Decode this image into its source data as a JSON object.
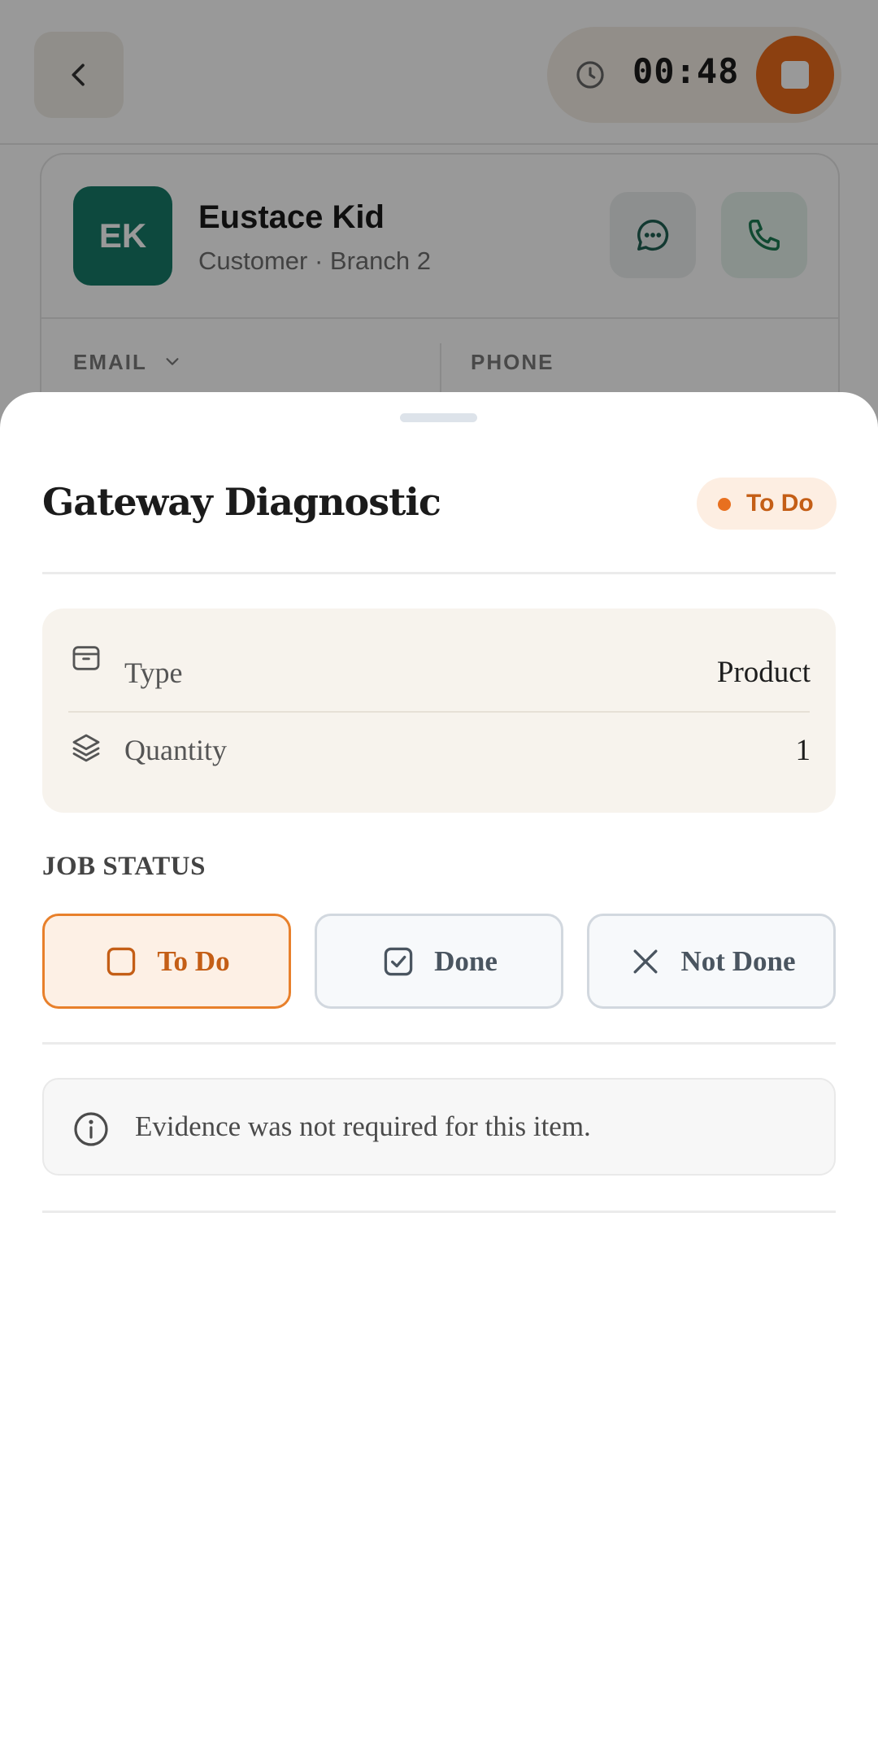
{
  "background": {
    "timer": {
      "elapsed": "00:48"
    },
    "customer": {
      "initials": "EK",
      "name": "Eustace Kid",
      "subtitle": "Customer · Branch 2",
      "email_label": "EMAIL",
      "phone_label": "PHONE",
      "avatar_color": "#167b68"
    }
  },
  "sheet": {
    "title": "Gateway Diagnostic",
    "status_badge": "To Do",
    "details": [
      {
        "label": "Type",
        "value": "Product",
        "icon": "package-icon"
      },
      {
        "label": "Quantity",
        "value": "1",
        "icon": "layers-icon"
      }
    ],
    "job_status": {
      "heading": "JOB STATUS",
      "options": [
        {
          "label": "To Do",
          "icon": "empty-checkbox-icon",
          "selected": true
        },
        {
          "label": "Done",
          "icon": "checked-box-icon",
          "selected": false
        },
        {
          "label": "Not Done",
          "icon": "x-icon",
          "selected": false
        }
      ]
    },
    "info_message": "Evidence was not required for this item."
  },
  "colors": {
    "accent": "#e8701f",
    "accent_text": "#c45e16",
    "accent_bg": "#fdeee2",
    "stop_button": "#ea6b1c"
  }
}
